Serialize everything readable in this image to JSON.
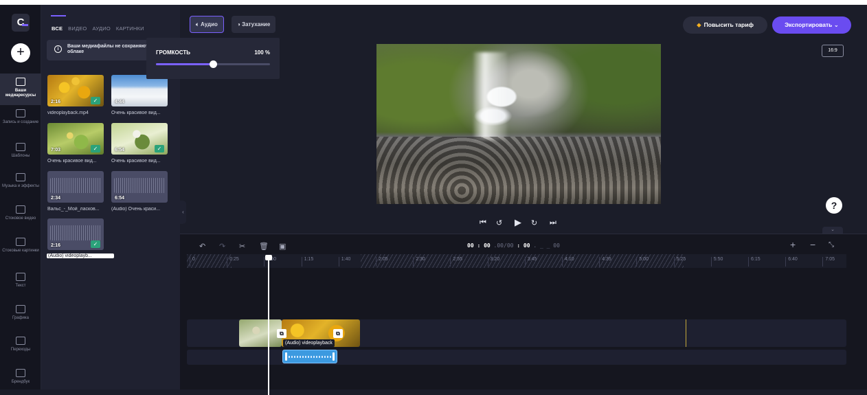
{
  "app": {
    "logo_letter": "C"
  },
  "sidebar": {
    "add_label": "+",
    "items": [
      {
        "label": "Ваши медиаресурсы",
        "active": true
      },
      {
        "label": "Запись и создание"
      },
      {
        "label": "Шаблоны"
      },
      {
        "label": "Музыка и эффекты"
      },
      {
        "label": "Стоковое видео"
      },
      {
        "label": "Стоковые картинки"
      },
      {
        "label": "Текст"
      },
      {
        "label": "Графика"
      },
      {
        "label": "Переходы"
      },
      {
        "label": "Брендбук"
      }
    ]
  },
  "media_panel": {
    "tabs": [
      "ВСЕ",
      "ВИДЕО",
      "АУДИО",
      "КАРТИНКИ"
    ],
    "notice": "Ваши медиафайлы не сохраняются в облаке",
    "items": [
      {
        "duration": "2:16",
        "caption": "videoplayback.mp4",
        "checked": true
      },
      {
        "duration": "4:44",
        "caption": "Очень красивое вид...",
        "checked": false
      },
      {
        "duration": "7:03",
        "caption": "Очень красивое вид...",
        "checked": true
      },
      {
        "duration": "6:54",
        "caption": "Очень красивое вид...",
        "checked": true
      },
      {
        "duration": "2:34",
        "caption": "Вальс_-_Мой_ласков...",
        "checked": false
      },
      {
        "duration": "6:54",
        "caption": "(Audio) Очень краси...",
        "checked": false
      },
      {
        "duration": "2:16",
        "caption": "(Audio) videoplayb...",
        "checked": true
      }
    ]
  },
  "toolbar": {
    "audio_label": "Аудио",
    "fade_label": "Затухание",
    "upgrade_label": "Повысить тариф",
    "export_label": "Экспортировать",
    "aspect_ratio": "16:9"
  },
  "volume": {
    "title": "ГРОМКОСТЬ",
    "value_text": "100 %",
    "level": 0.5
  },
  "timeline": {
    "current_time": "00 : 00",
    "current_frac": ".00/00",
    "total_time": ": 00",
    "total_frac": ". _ _ 00",
    "ticks": [
      "0",
      "0:25",
      "0:50",
      "1:15",
      "1:40",
      "2:05",
      "2:30",
      "2:55",
      "3:20",
      "3:45",
      "4:10",
      "4:35",
      "5:00",
      "5:25",
      "5:50",
      "6:15",
      "6:40",
      "7:05"
    ],
    "clip_label": "(Audio) videoplayback"
  },
  "colors": {
    "accent": "#7b61ff",
    "export_bg": "#6a4cf0",
    "check": "#2ba27a",
    "audio_clip": "#3c9ae0"
  }
}
